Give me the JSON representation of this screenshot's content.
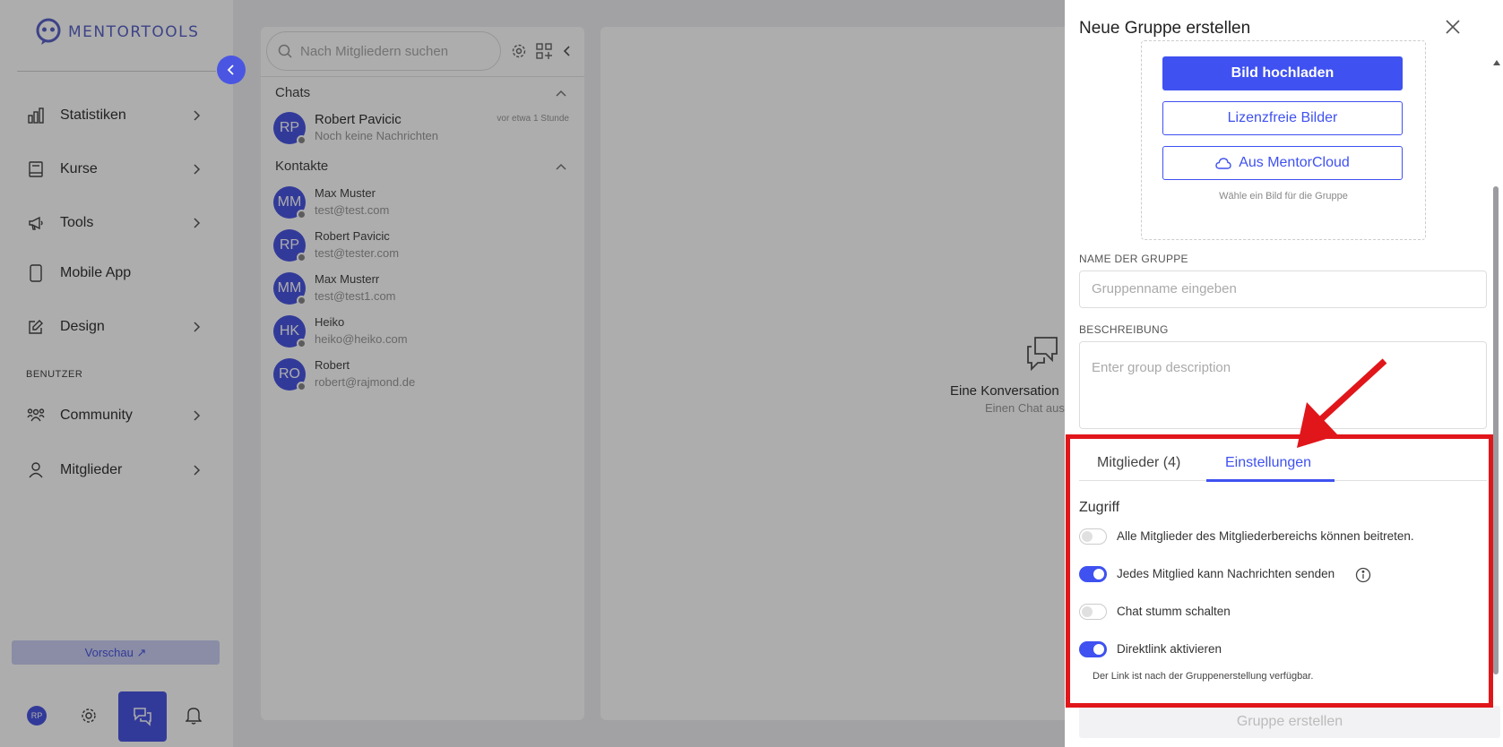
{
  "app": {
    "name": "MENTORTOOLS"
  },
  "sidebar": {
    "items": [
      {
        "label": "Statistiken"
      },
      {
        "label": "Kurse"
      },
      {
        "label": "Tools"
      },
      {
        "label": "Mobile App"
      },
      {
        "label": "Design"
      }
    ],
    "section_label": "BENUTZER",
    "user_items": [
      {
        "label": "Community"
      },
      {
        "label": "Mitglieder"
      }
    ],
    "preview_label": "Vorschau ↗",
    "user_initials": "RP"
  },
  "chat": {
    "search_placeholder": "Nach Mitgliedern suchen",
    "chats_header": "Chats",
    "contacts_header": "Kontakte",
    "chats": [
      {
        "initials": "RP",
        "name": "Robert Pavicic",
        "preview": "Noch keine Nachrichten",
        "time": "vor etwa 1 Stunde"
      }
    ],
    "contacts": [
      {
        "initials": "MM",
        "name": "Max Muster",
        "email": "test@test.com"
      },
      {
        "initials": "RP",
        "name": "Robert Pavicic",
        "email": "test@tester.com"
      },
      {
        "initials": "MM",
        "name": "Max Musterr",
        "email": "test@test1.com"
      },
      {
        "initials": "HK",
        "name": "Heiko",
        "email": "heiko@heiko.com"
      },
      {
        "initials": "RO",
        "name": "Robert",
        "email": "robert@rajmond.de"
      }
    ],
    "empty_title": "Eine Konversation",
    "empty_sub": "Einen Chat aus"
  },
  "drawer": {
    "title": "Neue Gruppe erstellen",
    "upload_button": "Bild hochladen",
    "free_images_button": "Lizenzfreie Bilder",
    "cloud_button": "Aus MentorCloud",
    "upload_hint": "Wähle ein Bild für die Gruppe",
    "name_label": "NAME DER GRUPPE",
    "name_placeholder": "Gruppenname eingeben",
    "description_label": "BESCHREIBUNG",
    "description_placeholder": "Enter group description",
    "tabs": [
      {
        "label": "Mitglieder (4)",
        "active": false
      },
      {
        "label": "Einstellungen",
        "active": true
      }
    ],
    "access_title": "Zugriff",
    "settings": [
      {
        "label": "Alle Mitglieder des Mitgliederbereichs können beitreten.",
        "enabled": false
      },
      {
        "label": "Jedes Mitglied kann Nachrichten senden",
        "enabled": true
      },
      {
        "label": "Chat stumm schalten",
        "enabled": false
      },
      {
        "label": "Direktlink aktivieren",
        "enabled": true
      }
    ],
    "link_hint": "Der Link ist nach der Gruppenerstellung verfügbar.",
    "submit_button": "Gruppe erstellen"
  },
  "colors": {
    "accent": "#3f51f0",
    "highlight": "#e0161b"
  }
}
